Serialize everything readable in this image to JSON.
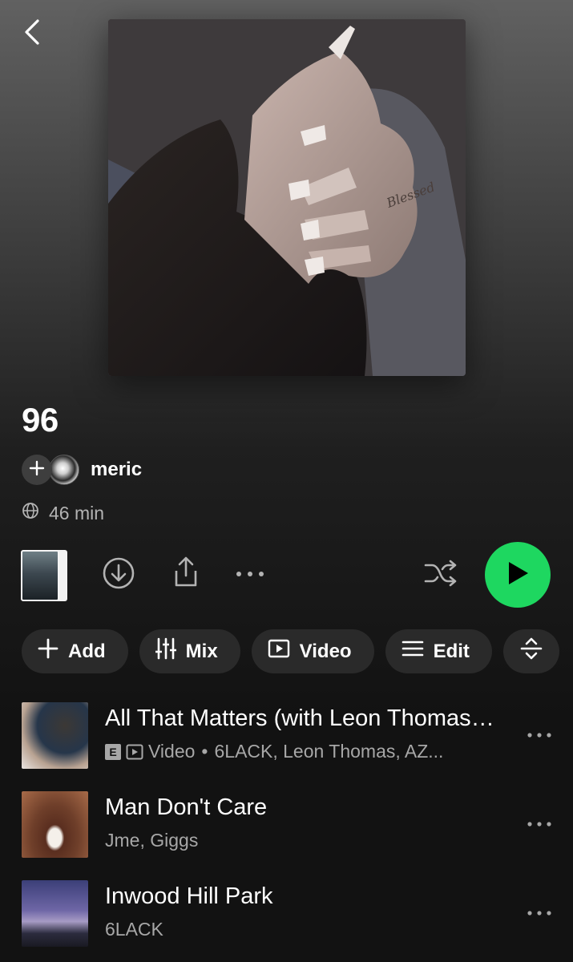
{
  "header": {
    "back_icon": "chevron-left-icon"
  },
  "playlist": {
    "title": "96",
    "owner_name": "meric",
    "duration": "46 min",
    "visibility_icon": "globe-icon"
  },
  "controls": {
    "download_icon": "download-circle-icon",
    "share_icon": "share-icon",
    "more_icon": "more-horizontal-icon",
    "shuffle_icon": "shuffle-icon",
    "play_icon": "play-icon",
    "play_color": "#1ed760"
  },
  "chips": [
    {
      "label": "Add",
      "icon": "plus-icon"
    },
    {
      "label": "Mix",
      "icon": "sliders-icon"
    },
    {
      "label": "Video",
      "icon": "video-play-icon"
    },
    {
      "label": "Edit",
      "icon": "list-icon"
    },
    {
      "label": "",
      "icon": "sort-icon"
    }
  ],
  "tracks": [
    {
      "title": "All That Matters (with Leon Thomas, AZ...",
      "explicit_badge": "E",
      "video_label": "Video",
      "separator": "•",
      "artists": "6LACK, Leon Thomas, AZ..."
    },
    {
      "title": "Man Don't Care",
      "artists": "Jme, Giggs"
    },
    {
      "title": "Inwood Hill Park",
      "artists": "6LACK"
    }
  ]
}
